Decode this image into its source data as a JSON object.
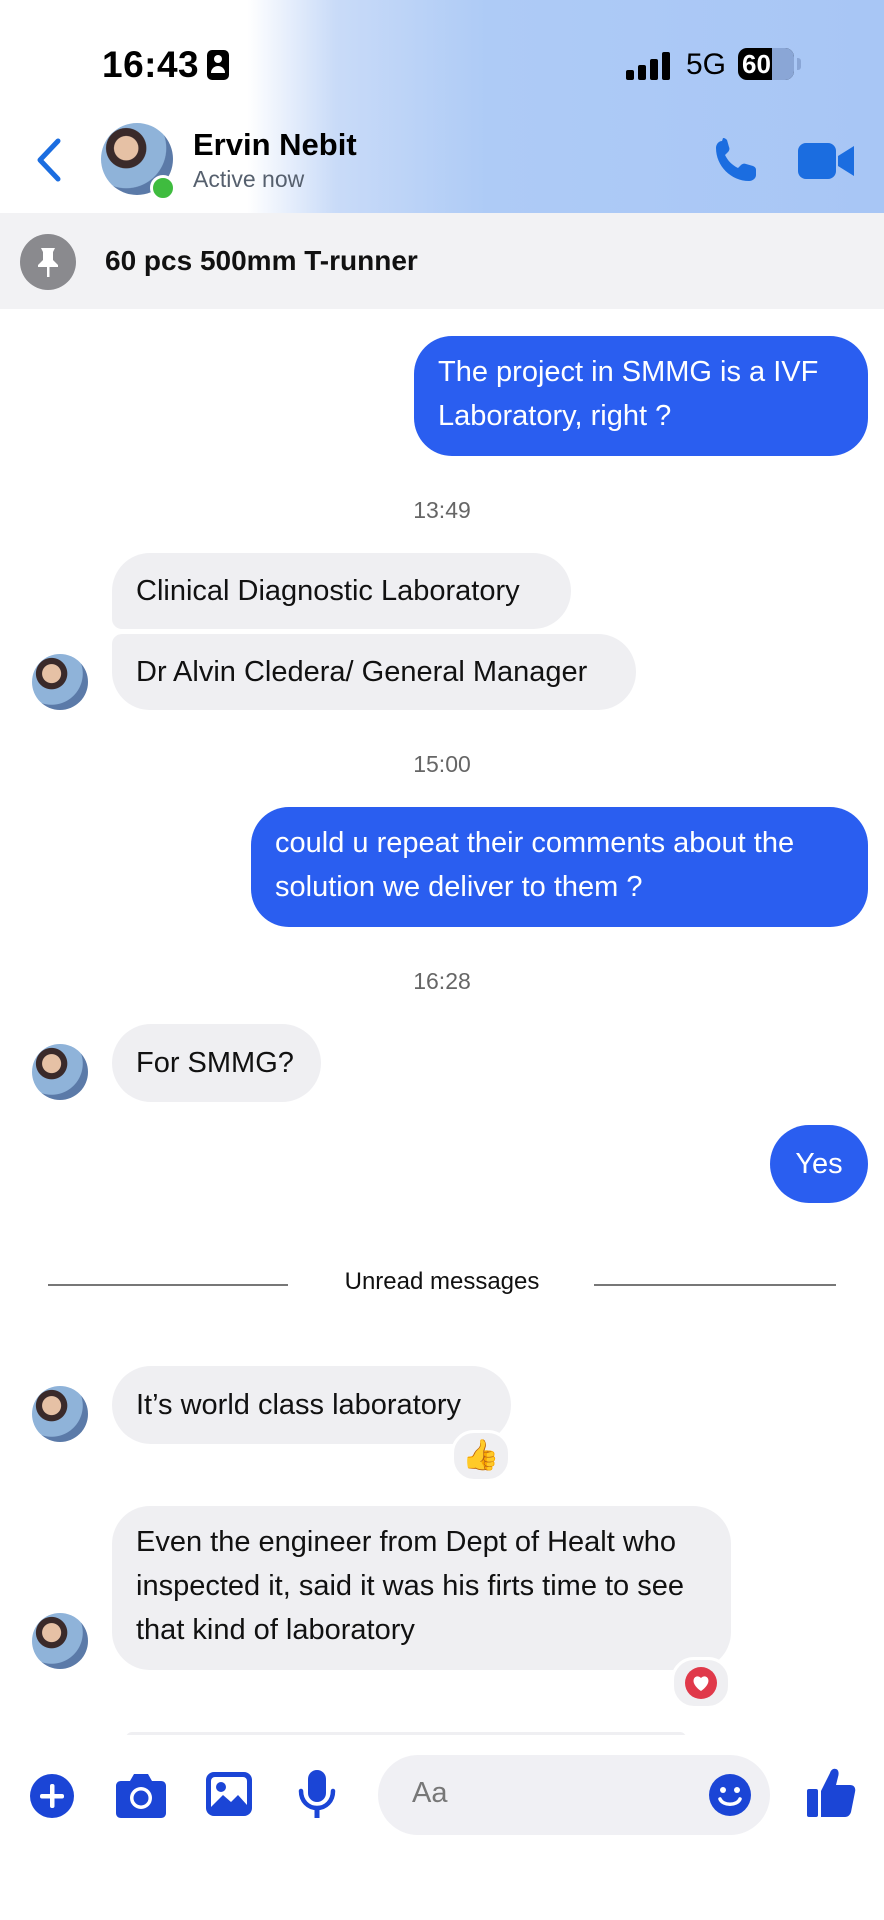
{
  "status": {
    "time": "16:43",
    "network": "5G",
    "battery": "60"
  },
  "header": {
    "name": "Ervin Nebit",
    "status": "Active now"
  },
  "pinned": {
    "text": "60 pcs 500mm T-runner"
  },
  "messages": {
    "m1": "The project in SMMG is a IVF Laboratory, right ?",
    "t1": "13:49",
    "m2": "Clinical Diagnostic Laboratory",
    "m3": "Dr Alvin Cledera/ General Manager",
    "t2": "15:00",
    "m4": "could u repeat their comments about the solution we deliver to them ?",
    "t3": "16:28",
    "m5": "For SMMG?",
    "m6": "Yes",
    "unread": "Unread messages",
    "m7": "It’s world class laboratory",
    "r7": "👍",
    "m8": "Even the engineer from Dept of Healt who inspected it, said it was his firts time to see that kind of laboratory",
    "r8": "❤"
  },
  "composer": {
    "placeholder": "Aa"
  },
  "colors": {
    "accent": "#2a5ef0",
    "icon": "#1b45d6",
    "incoming": "#efeff2"
  }
}
